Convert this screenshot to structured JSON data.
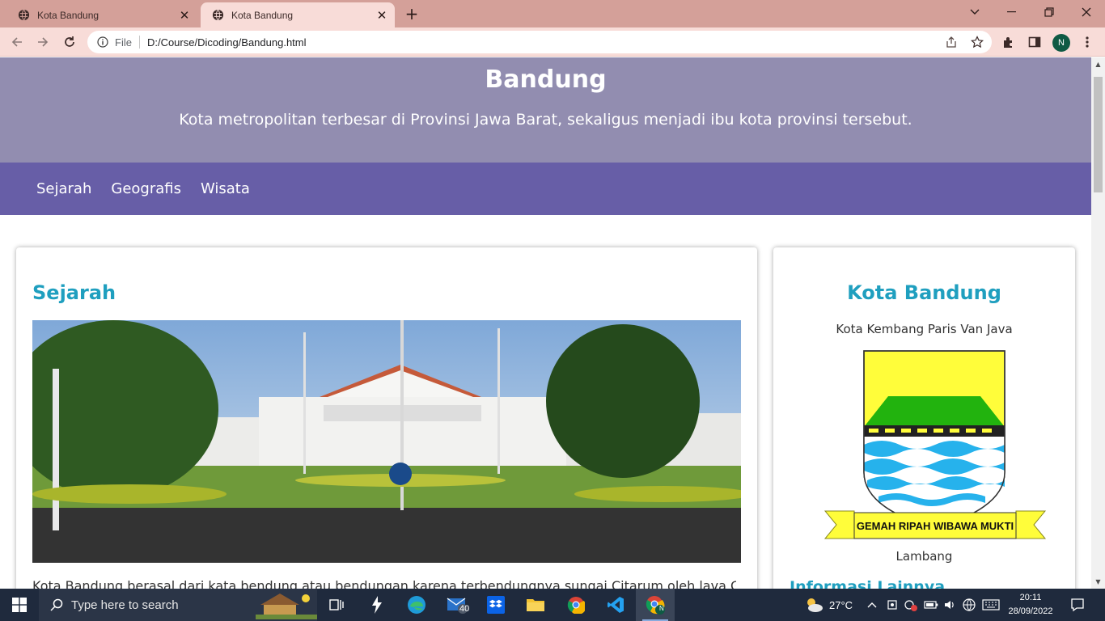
{
  "browser": {
    "tabs": [
      {
        "title": "Kota Bandung",
        "active": false
      },
      {
        "title": "Kota Bandung",
        "active": true
      }
    ],
    "address": {
      "scheme_label": "File",
      "url": "D:/Course/Dicoding/Bandung.html"
    },
    "profile_initial": "N"
  },
  "page": {
    "header": {
      "title": "Bandung",
      "subtitle": "Kota metropolitan terbesar di Provinsi Jawa Barat, sekaligus menjadi ibu kota provinsi tersebut."
    },
    "nav": [
      "Sejarah",
      "Geografis",
      "Wisata"
    ],
    "main": {
      "heading": "Sejarah",
      "text": "Kota Bandung berasal dari kata bendung atau bendungan karena terbendungnya sungai Citarum oleh lava Gunung"
    },
    "aside": {
      "heading": "Kota Bandung",
      "tagline": "Kota Kembang Paris Van Java",
      "emblem_motto": "GEMAH RIPAH WIBAWA MUKTI",
      "emblem_caption": "Lambang",
      "more_heading": "Informasi Lainnya"
    },
    "colors": {
      "header_bg": "#928db0",
      "nav_bg": "#675ea7",
      "heading": "#1f9fbf"
    }
  },
  "taskbar": {
    "search_placeholder": "Type here to search",
    "mail_badge": "40",
    "weather": "27°C",
    "time": "20:11",
    "date": "28/09/2022",
    "profile_initial": "N"
  }
}
